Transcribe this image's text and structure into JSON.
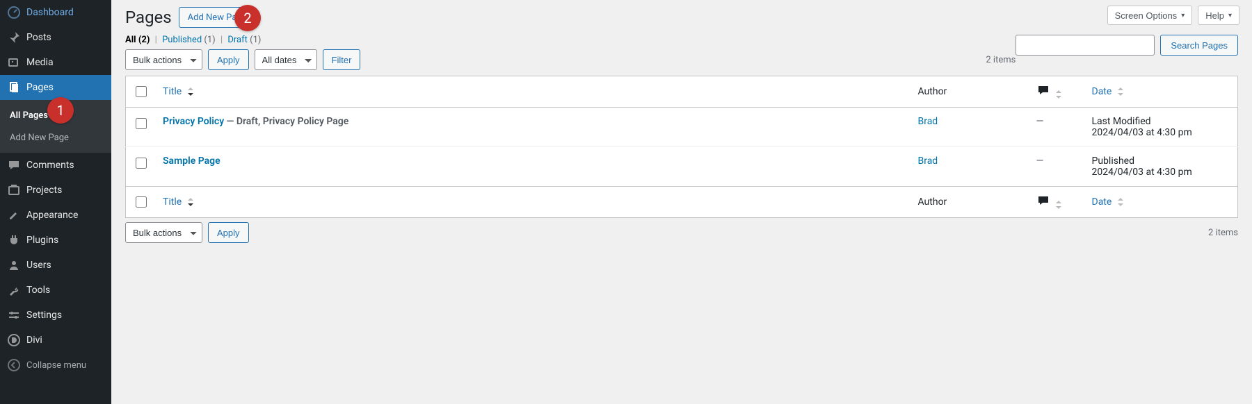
{
  "sidebar": {
    "items": [
      {
        "label": "Dashboard"
      },
      {
        "label": "Posts"
      },
      {
        "label": "Media"
      },
      {
        "label": "Pages"
      },
      {
        "label": "Comments"
      },
      {
        "label": "Projects"
      },
      {
        "label": "Appearance"
      },
      {
        "label": "Plugins"
      },
      {
        "label": "Users"
      },
      {
        "label": "Tools"
      },
      {
        "label": "Settings"
      },
      {
        "label": "Divi"
      }
    ],
    "submenu": [
      {
        "label": "All Pages"
      },
      {
        "label": "Add New Page"
      }
    ],
    "collapse": "Collapse menu"
  },
  "topbar": {
    "screen_options": "Screen Options",
    "help": "Help"
  },
  "heading": {
    "title": "Pages",
    "add_new": "Add New Page"
  },
  "views": {
    "all_label": "All",
    "all_count": "(2)",
    "pub_label": "Published",
    "pub_count": "(1)",
    "draft_label": "Draft",
    "draft_count": "(1)"
  },
  "bulk": {
    "label": "Bulk actions",
    "apply": "Apply"
  },
  "dates": {
    "label": "All dates",
    "filter": "Filter"
  },
  "search": {
    "placeholder": "",
    "button": "Search Pages"
  },
  "count": {
    "items": "2 items"
  },
  "columns": {
    "title": "Title",
    "author": "Author",
    "date": "Date"
  },
  "rows": [
    {
      "title": "Privacy Policy",
      "state": " — Draft, Privacy Policy Page",
      "author": "Brad",
      "comments": "—",
      "date_status": "Last Modified",
      "date_stamp": "2024/04/03 at 4:30 pm"
    },
    {
      "title": "Sample Page",
      "state": "",
      "author": "Brad",
      "comments": "—",
      "date_status": "Published",
      "date_stamp": "2024/04/03 at 4:30 pm"
    }
  ],
  "callouts": {
    "one": "1",
    "two": "2"
  }
}
